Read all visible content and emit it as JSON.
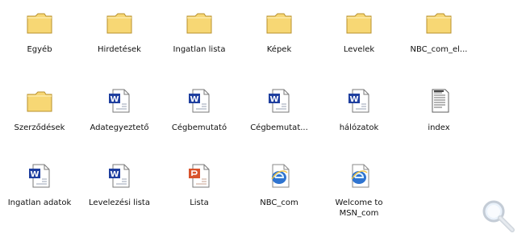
{
  "items": [
    {
      "label": "Egyéb",
      "icon": "folder-icon"
    },
    {
      "label": "Hirdetések",
      "icon": "folder-icon"
    },
    {
      "label": "Ingatlan lista",
      "icon": "folder-icon"
    },
    {
      "label": "Képek",
      "icon": "folder-icon"
    },
    {
      "label": "Levelek",
      "icon": "folder-icon"
    },
    {
      "label": "NBC_com_el...",
      "icon": "folder-icon"
    },
    {
      "label": "Szerződések",
      "icon": "folder-icon"
    },
    {
      "label": "Adategyeztető",
      "icon": "word-document-icon"
    },
    {
      "label": "Cégbemutató",
      "icon": "word-document-icon"
    },
    {
      "label": "Cégbemutat...",
      "icon": "word-document-icon"
    },
    {
      "label": "hálózatok",
      "icon": "word-document-icon"
    },
    {
      "label": "index",
      "icon": "text-document-icon"
    },
    {
      "label": "Ingatlan adatok",
      "icon": "word-document-icon"
    },
    {
      "label": "Levelezési lista",
      "icon": "word-document-icon"
    },
    {
      "label": "Lista",
      "icon": "powerpoint-document-icon"
    },
    {
      "label": "NBC_com",
      "icon": "internet-shortcut-icon"
    },
    {
      "label": "Welcome to MSN_com",
      "icon": "internet-shortcut-icon"
    }
  ],
  "zoom": {
    "icon": "magnifier-icon"
  },
  "colors": {
    "folder": "#f7d774",
    "folder_edge": "#b8902c",
    "word_blue": "#1f3f9f",
    "ppt_orange": "#d9532c",
    "ie_blue": "#2f74d0"
  }
}
